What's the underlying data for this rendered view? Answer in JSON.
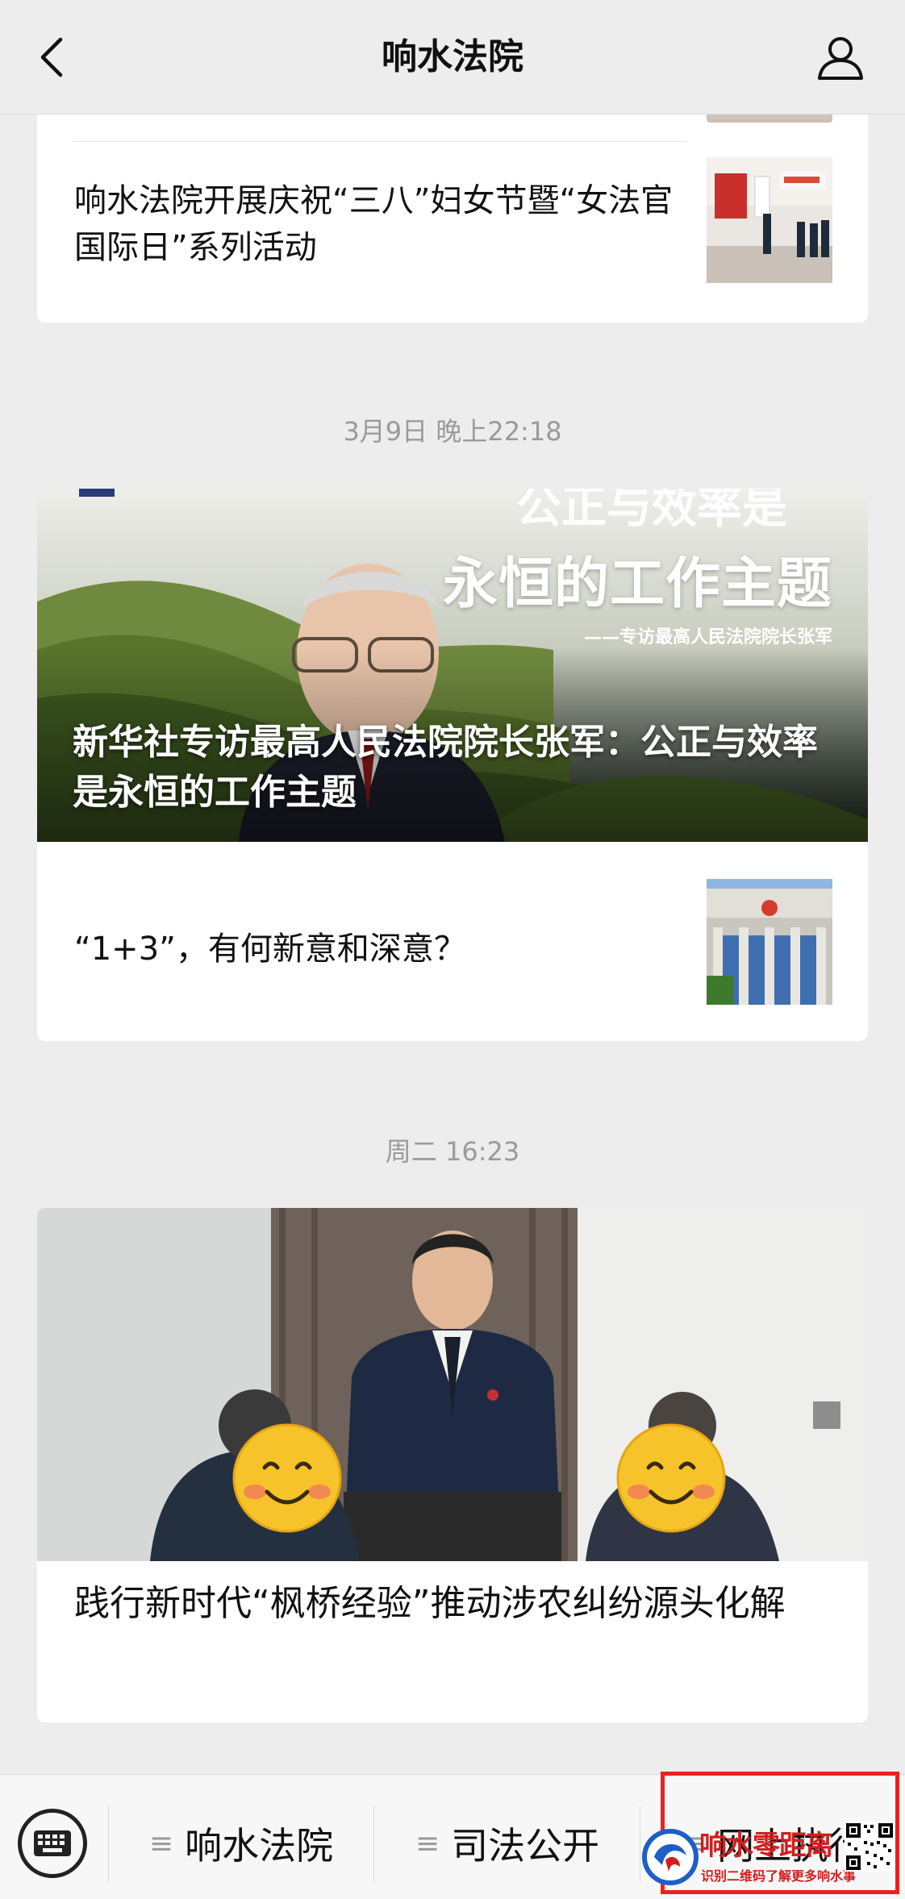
{
  "header": {
    "title": "响水法院",
    "back_icon": "chevron-left-icon",
    "profile_icon": "user-icon"
  },
  "feed": {
    "group1": {
      "item_title": "响水法院开展庆祝“三八”妇女节暨“女法官国际日”系列活动"
    },
    "group2": {
      "timestamp": "3月9日 晚上22:18",
      "hero_caption": "新华社专访最高人民法院院长张军：公正与效率是永恒的工作主题",
      "hero_image_text_top": "公正与效率是",
      "hero_image_text": "永恒的工作主题",
      "hero_image_subtext": "——专访最高人民法院院长张军",
      "item_title": "“1+3”，有何新意和深意？"
    },
    "group3": {
      "timestamp": "周二 16:23",
      "item_title": "践行新时代“枫桥经验”推动涉农纠纷源头化解"
    }
  },
  "bottom_menu": {
    "keyboard_icon": "keyboard-icon",
    "items": [
      {
        "label": "响水法院",
        "icon": "menu-lines-icon"
      },
      {
        "label": "司法公开",
        "icon": "menu-lines-icon"
      },
      {
        "label": "网上执行",
        "icon": "menu-lines-icon"
      }
    ]
  },
  "watermark": {
    "title": "响水零距离",
    "subtitle": "识别二维码了解更多响水事"
  },
  "colors": {
    "background": "#ededed",
    "card": "#ffffff",
    "timestamp": "#9a9a9a",
    "highlight_box": "#e8231f"
  }
}
